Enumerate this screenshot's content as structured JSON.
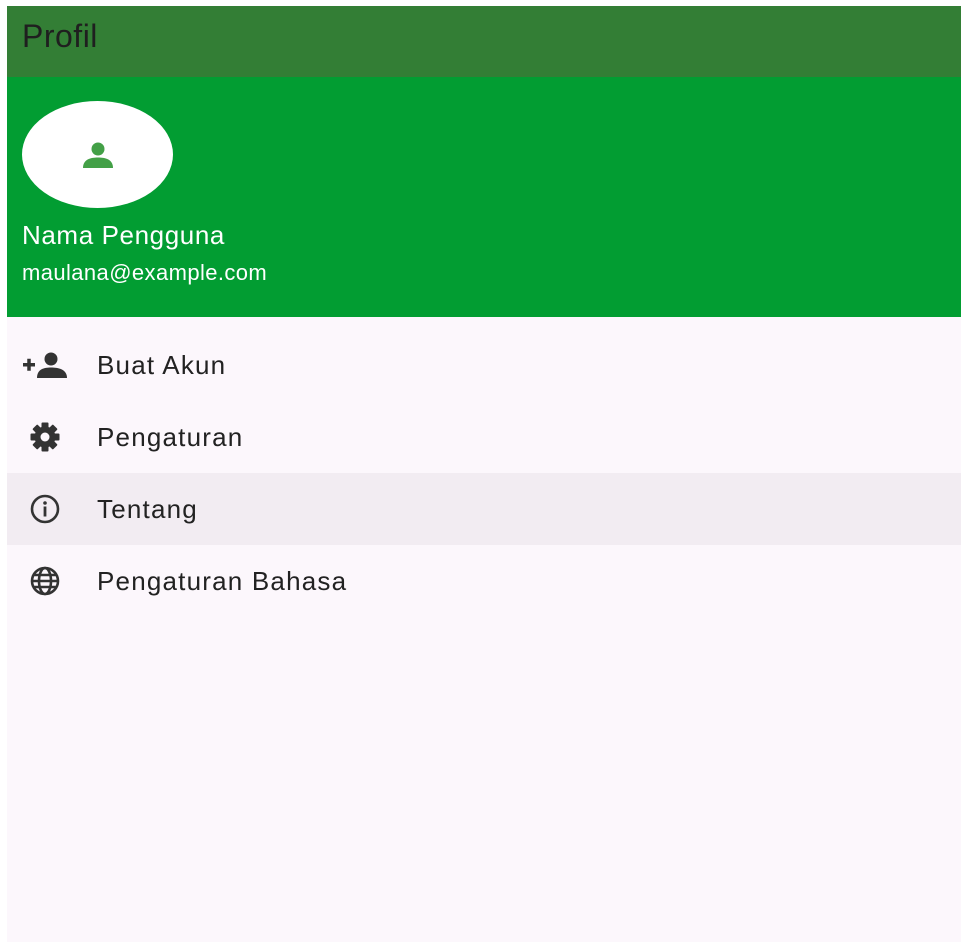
{
  "appbar": {
    "title": "Profil"
  },
  "header": {
    "avatar_icon": "person-icon",
    "name": "Nama Pengguna",
    "email": "maulana@example.com"
  },
  "menu": {
    "items": [
      {
        "label": "Buat Akun",
        "icon": "person-add-icon",
        "selected": false
      },
      {
        "label": "Pengaturan",
        "icon": "gear-icon",
        "selected": false
      },
      {
        "label": "Tentang",
        "icon": "info-icon",
        "selected": true
      },
      {
        "label": "Pengaturan Bahasa",
        "icon": "globe-icon",
        "selected": false
      }
    ]
  },
  "colors": {
    "appbar": "#337e35",
    "header": "#029d32",
    "avatar_icon": "#43a047",
    "background": "#fcf7fc",
    "selected_item": "#f2ecf2"
  }
}
